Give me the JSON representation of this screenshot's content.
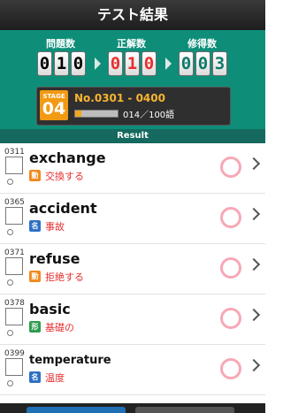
{
  "header": {
    "title": "テスト結果"
  },
  "stats": {
    "questions_label": "問題数",
    "questions_digits": [
      "0",
      "1",
      "0"
    ],
    "correct_label": "正解数",
    "correct_digits": [
      "0",
      "1",
      "0"
    ],
    "mastered_label": "修得数",
    "mastered_digits": [
      "0",
      "0",
      "3"
    ]
  },
  "stage": {
    "badge_word": "STAGE",
    "number": "04",
    "range": "No.0301 - 0400",
    "progress_text": "014／100語",
    "progress_fraction": 0.14
  },
  "result_header": "Result",
  "words": [
    {
      "num": "0311",
      "word": "exchange",
      "pos": "動",
      "pos_color": "#f08a1e",
      "meaning": "交換する"
    },
    {
      "num": "0365",
      "word": "accident",
      "pos": "名",
      "pos_color": "#2d6fc4",
      "meaning": "事故"
    },
    {
      "num": "0371",
      "word": "refuse",
      "pos": "動",
      "pos_color": "#f08a1e",
      "meaning": "拒絶する"
    },
    {
      "num": "0378",
      "word": "basic",
      "pos": "形",
      "pos_color": "#2f9b4e",
      "meaning": "基礎の"
    },
    {
      "num": "0399",
      "word": "temperature",
      "pos": "名",
      "pos_color": "#2d6fc4",
      "meaning": "温度"
    }
  ],
  "colors": {
    "accent_teal": "#0e8e79",
    "mark_red": "#e6302f",
    "circle_pink": "#f7a8b6"
  }
}
